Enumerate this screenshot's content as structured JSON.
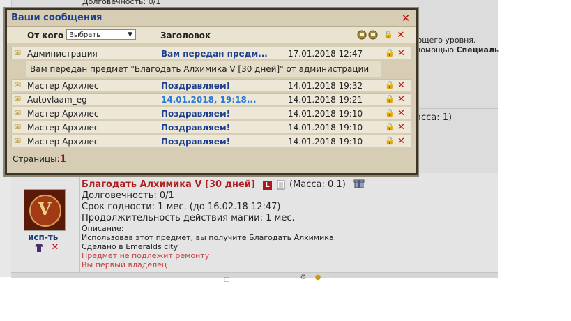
{
  "background": {
    "top_left_text": "Долговечность: 0/1",
    "right_text_1": "ющего уровня.",
    "right_text_2_prefix": "помощью ",
    "right_text_2_bold": "Специаль",
    "mass_text": "асса: 1)"
  },
  "item": {
    "title": "Благодать Алхимика V [30 дней]",
    "badge": "L",
    "mass": "(Масса: 0.1)",
    "durability": "Долговечность: 0/1",
    "expiry": "Срок годности: 1 мес. (до 16.02.18 12:47)",
    "magic_duration": "Продолжительность действия магии: 1 мес.",
    "description_label": "Описание:",
    "description": "Использовав этот предмет, вы получите Благодать Алхимика.",
    "made_in": "Сделано в Emeralds city",
    "no_repair": "Предмет не подлежит ремонту",
    "first_owner": "Вы первый владелец"
  },
  "user": {
    "nick": "исп-ть",
    "avatar_letter": "V"
  },
  "messages_window": {
    "title": "Ваши сообщения",
    "col_from": "От кого",
    "filter_value": "Выбрать",
    "col_subject": "Заголовок",
    "rows": [
      {
        "from": "Администрация",
        "subject": "Вам передан предм...",
        "date": "17.01.2018 12:47",
        "subject_style": "dark"
      },
      {
        "from": "Мастер Архилес",
        "subject": "Поздравляем!",
        "date": "14.01.2018 19:32",
        "subject_style": "dark"
      },
      {
        "from": "Autovlaam_eg",
        "subject": "14.01.2018, 19:18...",
        "date": "14.01.2018 19:21",
        "subject_style": "light"
      },
      {
        "from": "Мастер Архилес",
        "subject": "Поздравляем!",
        "date": "14.01.2018 19:10",
        "subject_style": "dark"
      },
      {
        "from": "Мастер Архилес",
        "subject": "Поздравляем!",
        "date": "14.01.2018 19:10",
        "subject_style": "dark"
      },
      {
        "from": "Мастер Архилес",
        "subject": "Поздравляем!",
        "date": "14.01.2018 19:10",
        "subject_style": "dark"
      }
    ],
    "preview_text": "Вам передан предмет \"Благодать Алхимика V [30 дней]\" от администрации",
    "pages_label": "Страницы:",
    "current_page": "1"
  },
  "colors": {
    "window_bg": "#d6cdb4",
    "title_blue": "#1d3f8e",
    "close_red": "#c01010",
    "item_title_red": "#b02020"
  }
}
